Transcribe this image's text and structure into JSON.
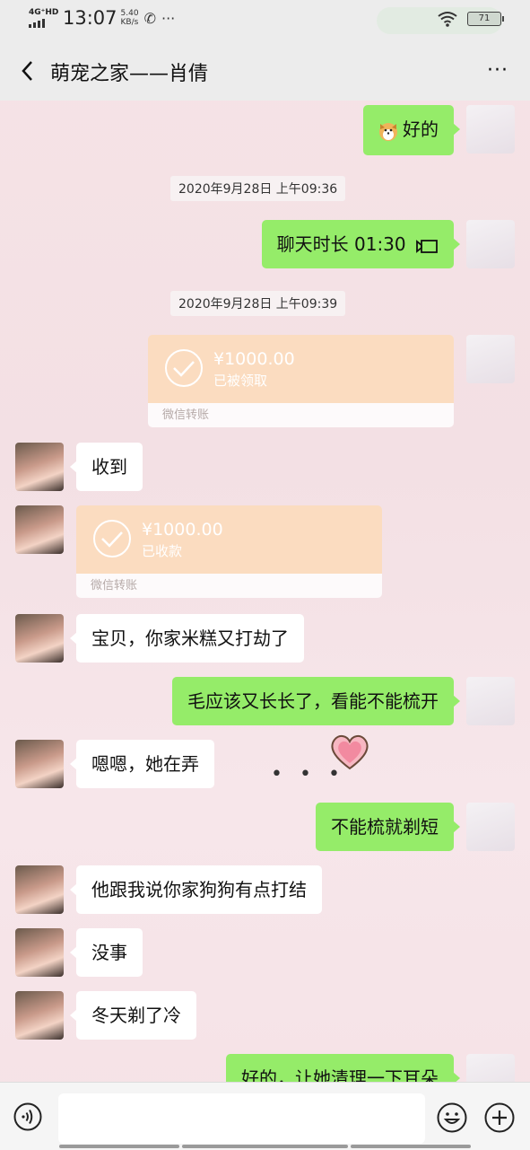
{
  "status_bar": {
    "network": "4G⁺HD",
    "time": "13:07",
    "speed_value": "5.40",
    "speed_unit": "KB/s",
    "more": "···",
    "battery": "71"
  },
  "header": {
    "title": "萌宠之家——肖倩",
    "more": "···"
  },
  "messages": [
    {
      "sender": "me",
      "text": "好的"
    },
    {
      "timestamp": "2020年9月28日 上午09:36"
    },
    {
      "sender": "me",
      "text": "聊天时长 01:30"
    },
    {
      "timestamp": "2020年9月28日 上午09:39"
    },
    {
      "sender": "me",
      "type": "transfer",
      "amount": "¥1000.00",
      "status": "已被领取",
      "footer": "微信转账"
    },
    {
      "sender": "other",
      "text": "收到"
    },
    {
      "sender": "other",
      "type": "transfer",
      "amount": "¥1000.00",
      "status": "已收款",
      "footer": "微信转账"
    },
    {
      "sender": "other",
      "text": "宝贝，你家米糕又打劫了"
    },
    {
      "sender": "me",
      "text": "毛应该又长长了，看能不能梳开"
    },
    {
      "sender": "other",
      "text": "嗯嗯，她在弄"
    },
    {
      "sender": "me",
      "text": "不能梳就剃短"
    },
    {
      "sender": "other",
      "text": "他跟我说你家狗狗有点打结"
    },
    {
      "sender": "other",
      "text": "没事"
    },
    {
      "sender": "other",
      "text": "冬天剃了冷"
    },
    {
      "sender": "me",
      "text": "好的，让她清理一下耳朵"
    }
  ],
  "decor": {
    "dots": "• • •"
  },
  "colors": {
    "my_bubble": "#95ec69",
    "other_bubble": "#ffffff",
    "transfer": "#fbdcc0"
  }
}
